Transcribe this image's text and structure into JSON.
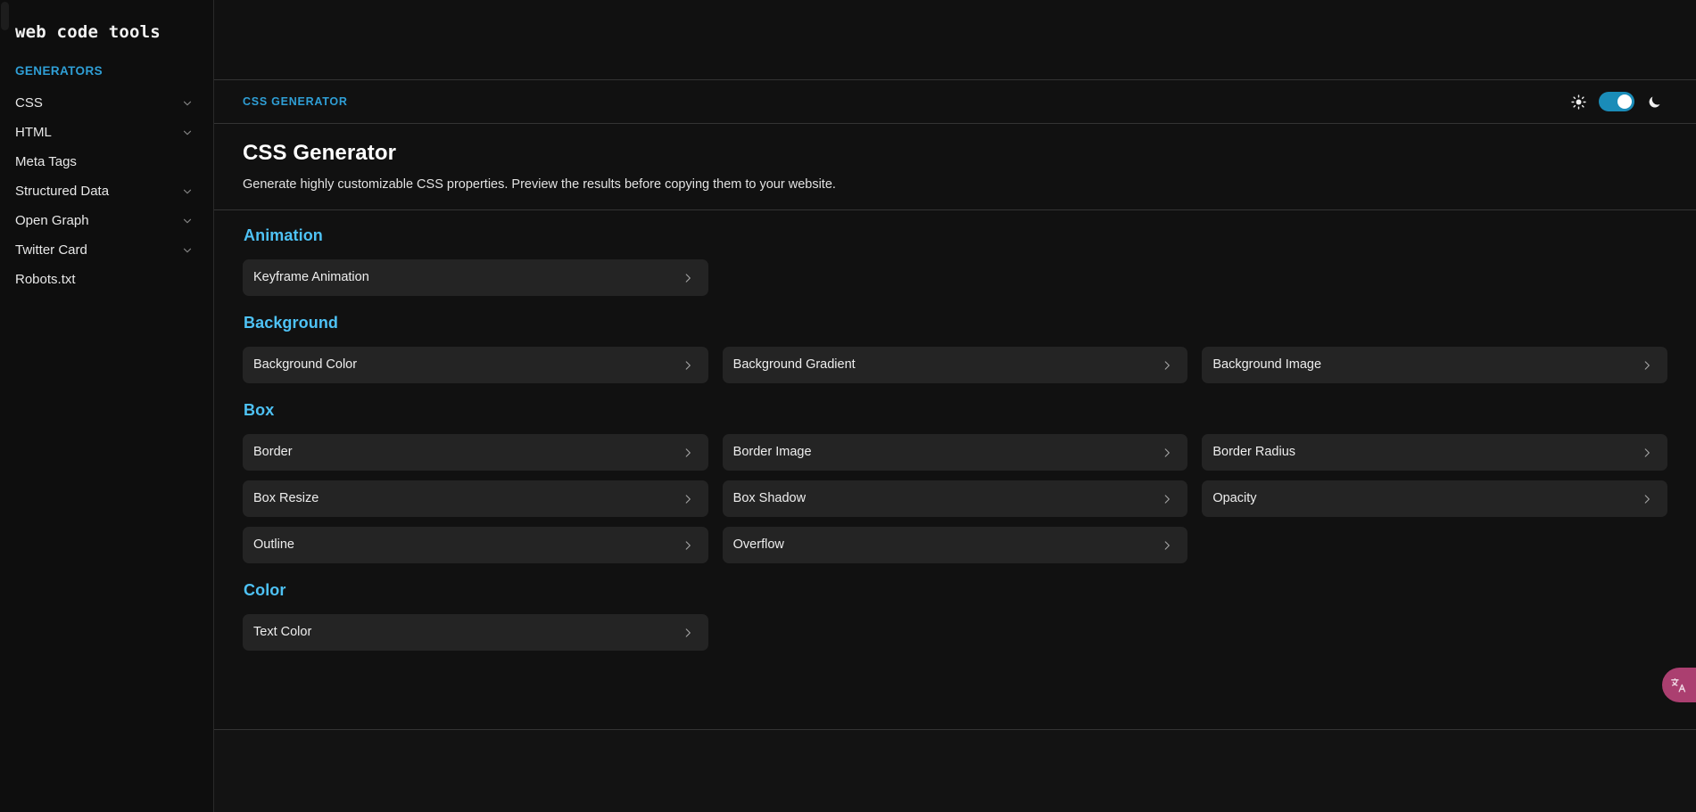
{
  "brand": {
    "name": "web code tools"
  },
  "sidebar": {
    "section_title": "GENERATORS",
    "items": [
      {
        "label": "CSS",
        "expandable": true,
        "icon": "chevron-down-icon"
      },
      {
        "label": "HTML",
        "expandable": true,
        "icon": "chevron-down-icon"
      },
      {
        "label": "Meta Tags",
        "expandable": false,
        "icon": ""
      },
      {
        "label": "Structured Data",
        "expandable": true,
        "icon": "chevron-down-icon"
      },
      {
        "label": "Open Graph",
        "expandable": true,
        "icon": "chevron-down-icon"
      },
      {
        "label": "Twitter Card",
        "expandable": true,
        "icon": "chevron-down-icon"
      },
      {
        "label": "Robots.txt",
        "expandable": false,
        "icon": ""
      }
    ]
  },
  "topbar": {
    "breadcrumb": "CSS GENERATOR",
    "theme": {
      "light_icon": "sun-icon",
      "dark_icon": "moon-icon",
      "toggle_state": "on",
      "toggle_color": "#1a8cb8",
      "knob_color": "#ffffff"
    }
  },
  "header": {
    "title": "CSS Generator",
    "subtitle": "Generate highly customizable CSS properties. Preview the results before copying them to your website."
  },
  "groups": [
    {
      "title": "Animation",
      "cards": [
        {
          "label": "Keyframe Animation",
          "icon": "chevron-right-icon"
        }
      ]
    },
    {
      "title": "Background",
      "cards": [
        {
          "label": "Background Color",
          "icon": "chevron-right-icon"
        },
        {
          "label": "Background Gradient",
          "icon": "chevron-right-icon"
        },
        {
          "label": "Background Image",
          "icon": "chevron-right-icon"
        }
      ]
    },
    {
      "title": "Box",
      "cards": [
        {
          "label": "Border",
          "icon": "chevron-right-icon"
        },
        {
          "label": "Border Image",
          "icon": "chevron-right-icon"
        },
        {
          "label": "Border Radius",
          "icon": "chevron-right-icon"
        },
        {
          "label": "Box Resize",
          "icon": "chevron-right-icon"
        },
        {
          "label": "Box Shadow",
          "icon": "chevron-right-icon"
        },
        {
          "label": "Opacity",
          "icon": "chevron-right-icon"
        },
        {
          "label": "Outline",
          "icon": "chevron-right-icon"
        },
        {
          "label": "Overflow",
          "icon": "chevron-right-icon"
        }
      ]
    },
    {
      "title": "Color",
      "cards": [
        {
          "label": "Text Color",
          "icon": "chevron-right-icon"
        }
      ]
    }
  ],
  "floating": {
    "translate": {
      "icon": "translate-icon",
      "color": "#ab3f70"
    }
  },
  "colors": {
    "page_bg": "#111111",
    "sidebar_bg": "#0e0e0e",
    "card_bg": "#242424",
    "accent_blue": "#4ec2f5",
    "breadcrumb_blue": "#2f9fd6",
    "divider": "#343434",
    "text_primary": "#eeeeee"
  }
}
